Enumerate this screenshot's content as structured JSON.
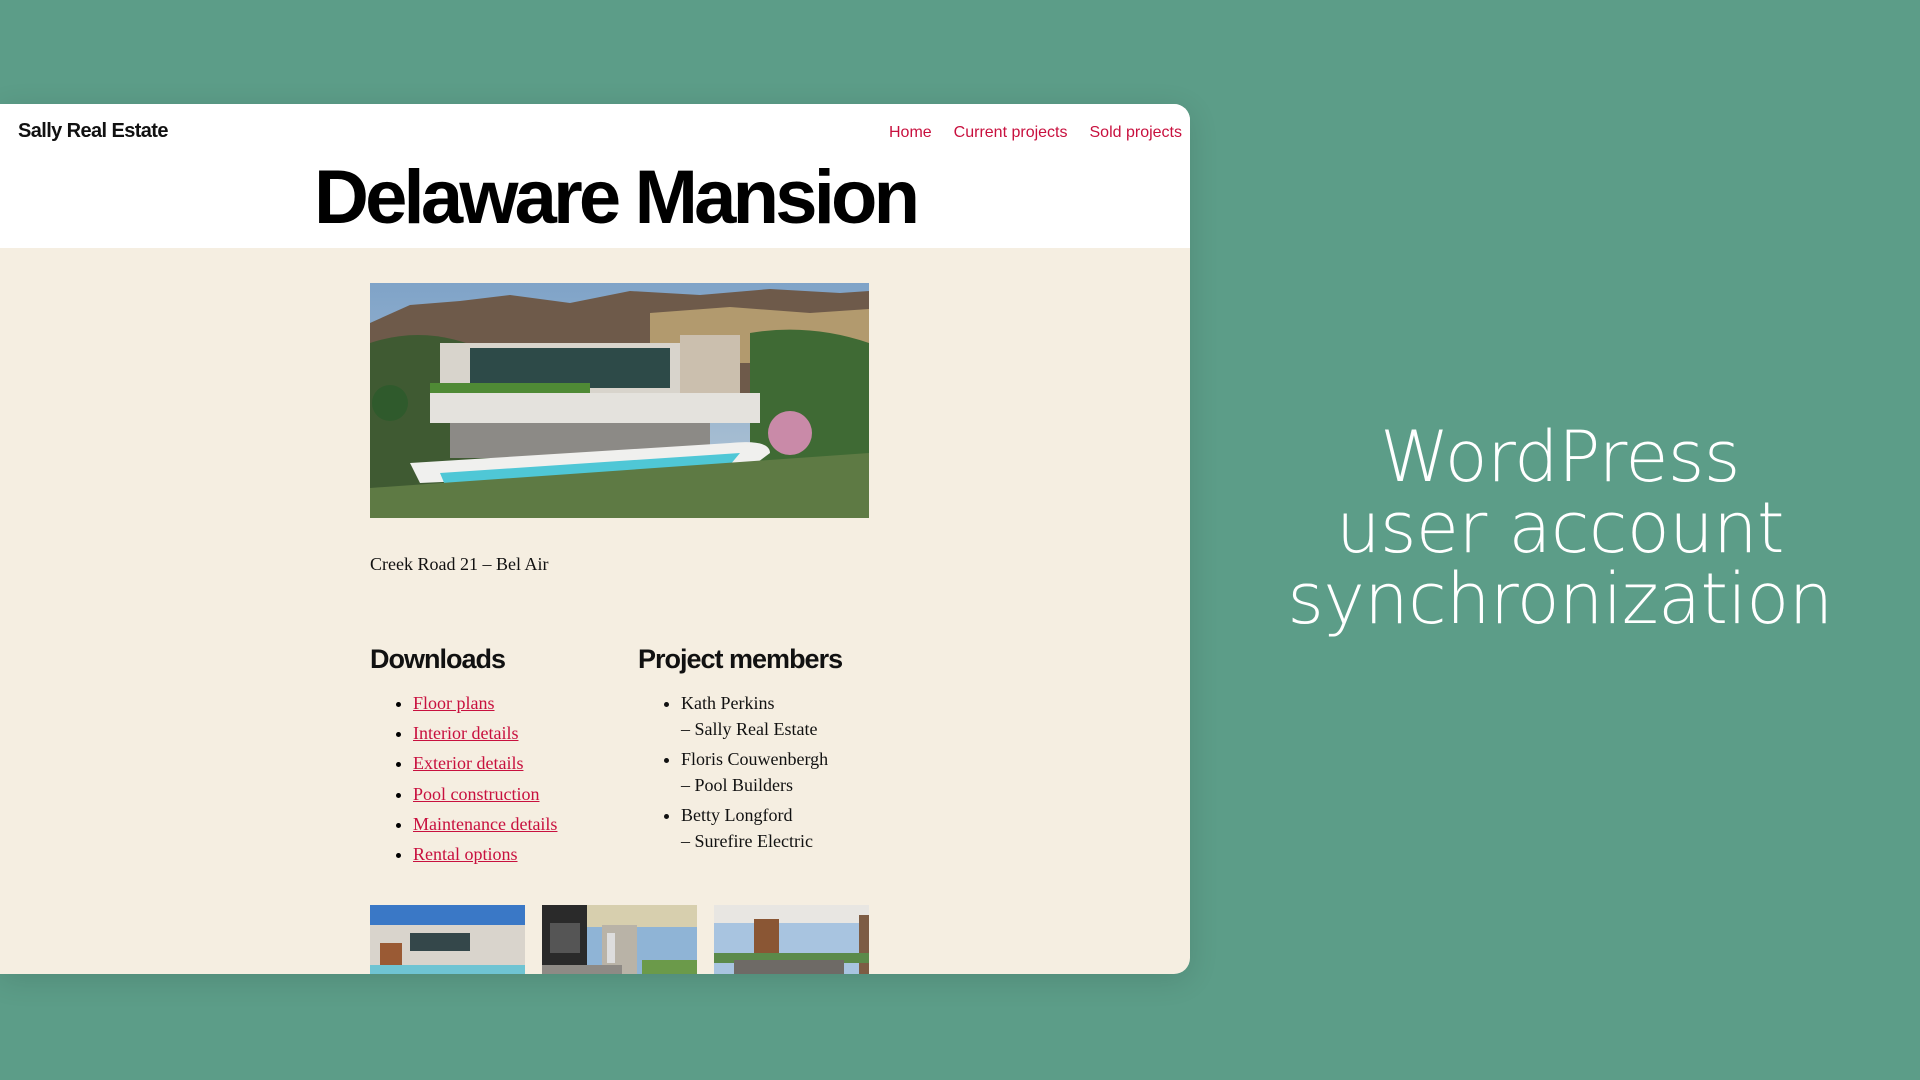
{
  "site": {
    "title": "Sally Real Estate",
    "nav": [
      {
        "label": "Home"
      },
      {
        "label": "Current projects"
      },
      {
        "label": "Sold projects"
      }
    ],
    "accent_color": "#c8103e"
  },
  "page": {
    "title": "Delaware Mansion",
    "hero_image": "modern-mansion-with-pool-photo",
    "address": "Creek Road 21 – Bel Air",
    "downloads": {
      "heading": "Downloads",
      "items": [
        {
          "label": "Floor plans"
        },
        {
          "label": "Interior details"
        },
        {
          "label": "Exterior details"
        },
        {
          "label": "Pool construction"
        },
        {
          "label": "Maintenance details"
        },
        {
          "label": "Rental options"
        }
      ]
    },
    "members": {
      "heading": "Project members",
      "items": [
        {
          "name": "Kath Perkins",
          "company": "– Sally Real Estate"
        },
        {
          "name": "Floris Couwenbergh",
          "company": "– Pool Builders"
        },
        {
          "name": "Betty Longford",
          "company": "– Surefire Electric"
        }
      ]
    },
    "gallery": [
      {
        "image": "exterior-pool-photo"
      },
      {
        "image": "covered-patio-photo"
      },
      {
        "image": "living-room-view-photo"
      }
    ]
  },
  "promo": {
    "headline_lines": [
      "WordPress",
      "user account",
      "synchronization"
    ],
    "background_color": "#5c9d88"
  }
}
